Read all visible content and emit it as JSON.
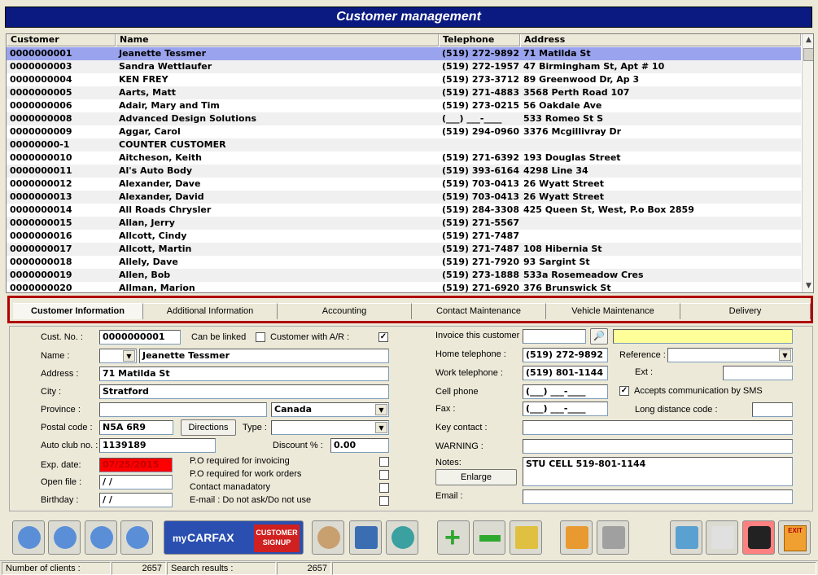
{
  "window": {
    "title": "Customer management"
  },
  "grid": {
    "columns": [
      "Customer",
      "Name",
      "Telephone",
      "Address"
    ],
    "rows": [
      [
        "0000000001",
        "Jeanette Tessmer",
        "(519) 272-9892",
        "71 Matilda St"
      ],
      [
        "0000000003",
        "Sandra Wettlaufer",
        "(519) 272-1957",
        "47 Birmingham St, Apt # 10"
      ],
      [
        "0000000004",
        " KEN FREY",
        "(519) 273-3712",
        "89 Greenwood Dr, Ap 3"
      ],
      [
        "0000000005",
        "Aarts, Matt",
        "(519) 271-4883",
        "3568 Perth Road 107"
      ],
      [
        "0000000006",
        "Adair, Mary and Tim",
        "(519) 273-0215",
        "56 Oakdale Ave"
      ],
      [
        "0000000008",
        "Advanced Design Solutions",
        "(___) ___-____",
        "533 Romeo St S"
      ],
      [
        "0000000009",
        "Aggar, Carol",
        "(519) 294-0960",
        "3376 Mcgillivray Dr"
      ],
      [
        "00000000-1",
        "COUNTER CUSTOMER",
        "",
        ""
      ],
      [
        "0000000010",
        "Aitcheson, Keith",
        "(519) 271-6392",
        "193 Douglas Street"
      ],
      [
        "0000000011",
        "Al's Auto Body",
        "(519) 393-6164",
        "4298 Line 34"
      ],
      [
        "0000000012",
        "Alexander, Dave",
        "(519) 703-0413",
        "26 Wyatt Street"
      ],
      [
        "0000000013",
        "Alexander, David",
        "(519) 703-0413",
        "26 Wyatt Street"
      ],
      [
        "0000000014",
        "All Roads Chrysler",
        "(519) 284-3308",
        "425 Queen St, West, P.o Box 2859"
      ],
      [
        "0000000015",
        "Allan, Jerry",
        "(519) 271-5567",
        ""
      ],
      [
        "0000000016",
        "Allcott, Cindy",
        "(519) 271-7487",
        ""
      ],
      [
        "0000000017",
        "Allcott, Martin",
        "(519) 271-7487",
        "108 Hibernia St"
      ],
      [
        "0000000018",
        "Allely, Dave",
        "(519) 271-7920",
        "93 Sargint St"
      ],
      [
        "0000000019",
        "Allen, Bob",
        "(519) 273-1888",
        "533a Rosemeadow Cres"
      ],
      [
        "0000000020",
        "Allman, Marion",
        "(519) 271-6920",
        "376 Brunswick St"
      ]
    ],
    "selected_index": 0
  },
  "tabs": [
    "Customer Information",
    "Additional Information",
    "Accounting",
    "Contact Maintenance",
    "Vehicle Maintenance",
    "Delivery"
  ],
  "form": {
    "cust_no_label": "Cust. No. :",
    "cust_no": "0000000001",
    "can_be_linked_label": "Can be linked",
    "ar_label": "Customer with A/R :",
    "name_label": "Name :",
    "name": "Jeanette Tessmer",
    "address_label": "Address :",
    "address": "71 Matilda St",
    "city_label": "City :",
    "city": "Stratford",
    "province_label": "Province :",
    "province": "",
    "country": "Canada",
    "postal_label": "Postal code :",
    "postal": "N5A 6R9",
    "directions_label": "Directions",
    "type_label": "Type :",
    "autoclub_label": "Auto club no. :",
    "autoclub": "1139189",
    "discount_label": "Discount % :",
    "discount": "0.00",
    "exp_label": "Exp. date:",
    "exp": "07/25/2015",
    "openfile_label": "Open file :",
    "openfile": " / /",
    "birthday_label": "Birthday :",
    "birthday": " / /",
    "po_invoicing": "P.O required for invoicing",
    "po_workorders": "P.O required for work orders",
    "contact_mandatory": "Contact manadatory",
    "email_dnu": "E-mail : Do not ask/Do not use",
    "invoice_label": "Invoice this customer",
    "home_tel_label": "Home telephone :",
    "home_tel": "(519) 272-9892",
    "reference_label": "Reference :",
    "work_tel_label": "Work telephone :",
    "work_tel": "(519) 801-1144",
    "ext_label": "Ext :",
    "cell_label": "Cell phone",
    "cell": "(___) ___-____",
    "sms_label": "Accepts communication by SMS",
    "fax_label": "Fax :",
    "fax": "(___) ___-____",
    "ldc_label": "Long distance code :",
    "keycontact_label": "Key contact :",
    "warning_label": "WARNING :",
    "notes_label": "Notes:",
    "notes": "STU CELL 519-801-1144",
    "enlarge_label": "Enlarge",
    "email_label": "Email :"
  },
  "toolbar": {
    "carfax_prefix": "my",
    "carfax_brand": "CARFAX",
    "carfax_signup_1": "CUSTOMER",
    "carfax_signup_2": "SIGNUP",
    "exit_label": "EXIT"
  },
  "status": {
    "clients_label": "Number of clients :",
    "clients": "2657",
    "results_label": "Search results :",
    "results": "2657"
  },
  "colors": {
    "title_bg": "#0a1a80",
    "selected_row": "#9aa4ee",
    "exp_date_bg": "#ff0000",
    "invoice_highlight": "#ffff99",
    "tab_frame": "#b00000"
  }
}
